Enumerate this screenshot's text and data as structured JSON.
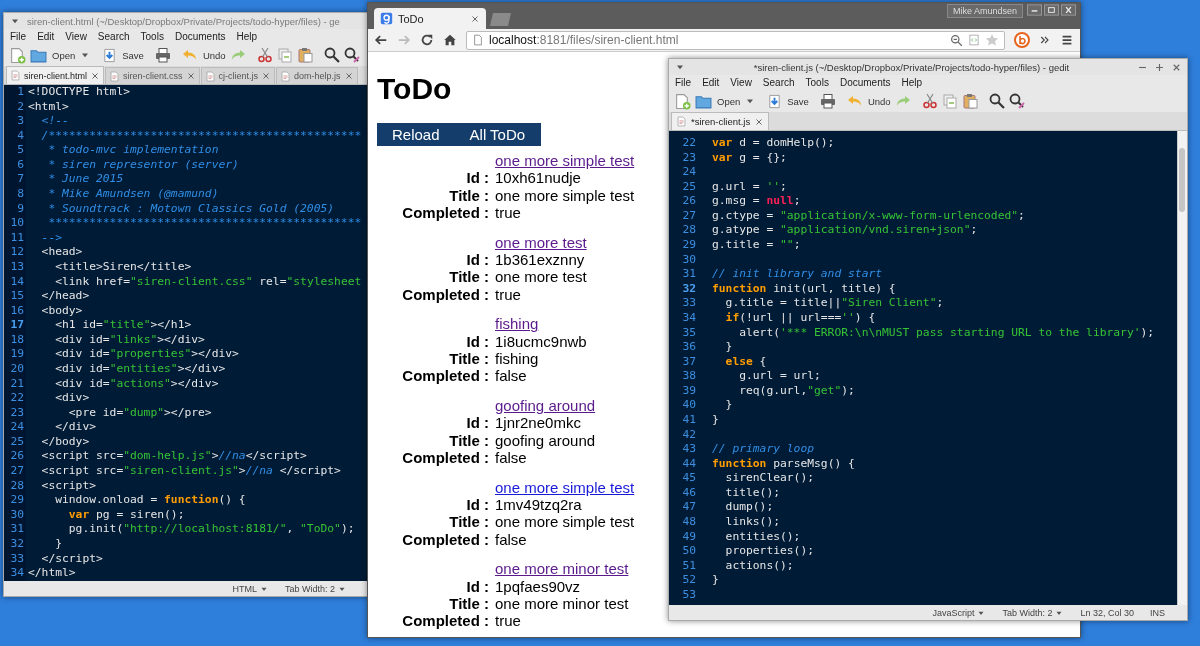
{
  "windows": [
    {
      "kind": "editor",
      "active": false,
      "window_buttons": false,
      "scrollbar": false,
      "title": "siren-client.html (~/Desktop/Dropbox/Private/Projects/todo-hyper/files) - ge",
      "menu": [
        "File",
        "Edit",
        "View",
        "Search",
        "Tools",
        "Documents",
        "Help"
      ],
      "toolbar": {
        "open": "Open",
        "save": "Save",
        "undo": "Undo"
      },
      "tabs": [
        {
          "label": "siren-client.html",
          "selected": true
        },
        {
          "label": "siren-client.css",
          "selected": false
        },
        {
          "label": "cj-client.js",
          "selected": false
        },
        {
          "label": "dom-help.js",
          "selected": false
        }
      ],
      "lines": [
        {
          "number": "1",
          "current": false,
          "tokens": [
            {
              "kind": "text",
              "text": "<!DOCTYPE html>"
            }
          ]
        },
        {
          "number": "2",
          "current": false,
          "tokens": [
            {
              "kind": "text",
              "text": "<html>"
            }
          ]
        },
        {
          "number": "3",
          "current": false,
          "tokens": [
            {
              "kind": "comment",
              "text": "  <!--"
            }
          ]
        },
        {
          "number": "4",
          "current": false,
          "tokens": [
            {
              "kind": "comment",
              "text": "  /**********************************************"
            }
          ]
        },
        {
          "number": "5",
          "current": false,
          "tokens": [
            {
              "kind": "comment",
              "text": "   * todo-mvc implementation"
            }
          ]
        },
        {
          "number": "6",
          "current": false,
          "tokens": [
            {
              "kind": "comment",
              "text": "   * siren representor (server)"
            }
          ]
        },
        {
          "number": "7",
          "current": false,
          "tokens": [
            {
              "kind": "comment",
              "text": "   * June 2015"
            }
          ]
        },
        {
          "number": "8",
          "current": false,
          "tokens": [
            {
              "kind": "comment",
              "text": "   * Mike Amundsen (@mamund)"
            }
          ]
        },
        {
          "number": "9",
          "current": false,
          "tokens": [
            {
              "kind": "comment",
              "text": "   * Soundtrack : Motown Classics Gold (2005)"
            }
          ]
        },
        {
          "number": "10",
          "current": false,
          "tokens": [
            {
              "kind": "comment",
              "text": "   **********************************************"
            }
          ]
        },
        {
          "number": "11",
          "current": false,
          "tokens": [
            {
              "kind": "comment",
              "text": "  -->"
            }
          ]
        },
        {
          "number": "12",
          "current": false,
          "tokens": [
            {
              "kind": "text",
              "text": "  <head>"
            }
          ]
        },
        {
          "number": "13",
          "current": false,
          "tokens": [
            {
              "kind": "text",
              "text": "    <title>Siren</title>"
            }
          ]
        },
        {
          "number": "14",
          "current": false,
          "tokens": [
            {
              "kind": "text",
              "text": "    <link href="
            },
            {
              "kind": "string",
              "text": "\"siren-client.css\""
            },
            {
              "kind": "text",
              "text": " rel="
            },
            {
              "kind": "string",
              "text": "\"stylesheet"
            }
          ]
        },
        {
          "number": "15",
          "current": false,
          "tokens": [
            {
              "kind": "text",
              "text": "  </head>"
            }
          ]
        },
        {
          "number": "16",
          "current": false,
          "tokens": [
            {
              "kind": "text",
              "text": "  <body>"
            }
          ]
        },
        {
          "number": "17",
          "current": true,
          "tokens": [
            {
              "kind": "text",
              "text": "    <h1 id="
            },
            {
              "kind": "string",
              "text": "\"title\""
            },
            {
              "kind": "text",
              "text": "></h1>"
            }
          ]
        },
        {
          "number": "18",
          "current": false,
          "tokens": [
            {
              "kind": "text",
              "text": "    <div id="
            },
            {
              "kind": "string",
              "text": "\"links\""
            },
            {
              "kind": "text",
              "text": "></div>"
            }
          ]
        },
        {
          "number": "19",
          "current": false,
          "tokens": [
            {
              "kind": "text",
              "text": "    <div id="
            },
            {
              "kind": "string",
              "text": "\"properties\""
            },
            {
              "kind": "text",
              "text": "></div>"
            }
          ]
        },
        {
          "number": "20",
          "current": false,
          "tokens": [
            {
              "kind": "text",
              "text": "    <div id="
            },
            {
              "kind": "string",
              "text": "\"entities\""
            },
            {
              "kind": "text",
              "text": "></div>"
            }
          ]
        },
        {
          "number": "21",
          "current": false,
          "tokens": [
            {
              "kind": "text",
              "text": "    <div id="
            },
            {
              "kind": "string",
              "text": "\"actions\""
            },
            {
              "kind": "text",
              "text": "></div>"
            }
          ]
        },
        {
          "number": "22",
          "current": false,
          "tokens": [
            {
              "kind": "text",
              "text": "    <div>"
            }
          ]
        },
        {
          "number": "23",
          "current": false,
          "tokens": [
            {
              "kind": "text",
              "text": "      <pre id="
            },
            {
              "kind": "string",
              "text": "\"dump\""
            },
            {
              "kind": "text",
              "text": "></pre>"
            }
          ]
        },
        {
          "number": "24",
          "current": false,
          "tokens": [
            {
              "kind": "text",
              "text": "    </div>"
            }
          ]
        },
        {
          "number": "25",
          "current": false,
          "tokens": [
            {
              "kind": "text",
              "text": "  </body>"
            }
          ]
        },
        {
          "number": "26",
          "current": false,
          "tokens": [
            {
              "kind": "text",
              "text": "  <script src="
            },
            {
              "kind": "string",
              "text": "\"dom-help.js\""
            },
            {
              "kind": "text",
              "text": ">"
            },
            {
              "kind": "comment",
              "text": "//na"
            },
            {
              "kind": "text",
              "text": "</script>"
            }
          ]
        },
        {
          "number": "27",
          "current": false,
          "tokens": [
            {
              "kind": "text",
              "text": "  <script src="
            },
            {
              "kind": "string",
              "text": "\"siren-client.js\""
            },
            {
              "kind": "text",
              "text": ">"
            },
            {
              "kind": "comment",
              "text": "//na "
            },
            {
              "kind": "text",
              "text": "</script>"
            }
          ]
        },
        {
          "number": "28",
          "current": false,
          "tokens": [
            {
              "kind": "text",
              "text": "  <script>"
            }
          ]
        },
        {
          "number": "29",
          "current": false,
          "tokens": [
            {
              "kind": "text",
              "text": "    window.onload = "
            },
            {
              "kind": "keyword",
              "text": "function"
            },
            {
              "kind": "text",
              "text": "() {"
            }
          ]
        },
        {
          "number": "30",
          "current": false,
          "tokens": [
            {
              "kind": "keyword",
              "text": "      var"
            },
            {
              "kind": "text",
              "text": " pg = siren();"
            }
          ]
        },
        {
          "number": "31",
          "current": false,
          "tokens": [
            {
              "kind": "text",
              "text": "      pg.init("
            },
            {
              "kind": "string",
              "text": "\"http://localhost:8181/\""
            },
            {
              "kind": "text",
              "text": ", "
            },
            {
              "kind": "string",
              "text": "\"ToDo\""
            },
            {
              "kind": "text",
              "text": ");"
            }
          ]
        },
        {
          "number": "32",
          "current": false,
          "tokens": [
            {
              "kind": "text",
              "text": "    }"
            }
          ]
        },
        {
          "number": "33",
          "current": false,
          "tokens": [
            {
              "kind": "text",
              "text": "  </script>"
            }
          ]
        },
        {
          "number": "34",
          "current": false,
          "tokens": [
            {
              "kind": "text",
              "text": "</html>"
            }
          ]
        }
      ],
      "status": [
        {
          "kind": "menu",
          "text": "HTML"
        },
        {
          "kind": "menu",
          "text": "Tab Width: 2"
        }
      ]
    },
    {
      "kind": "browser",
      "window_buttons": true,
      "profile": "Mike Amundsen",
      "tabs": [
        {
          "label": "ToDo",
          "selected": true
        }
      ],
      "address": "**localhost**:8181/files/siren-client.html",
      "page": {
        "heading": "ToDo",
        "nav": [
          "Reload",
          "All ToDo"
        ],
        "items": [
          {
            "link": "one more simple test",
            "visited": true,
            "fields": [
              {
                "label": "Id :",
                "value": "10xh61nudje"
              },
              {
                "label": "Title :",
                "value": "one more simple test"
              },
              {
                "label": "Completed :",
                "value": "true"
              }
            ]
          },
          {
            "link": "one more test",
            "visited": true,
            "fields": [
              {
                "label": "Id :",
                "value": "1b361exznny"
              },
              {
                "label": "Title :",
                "value": "one more test"
              },
              {
                "label": "Completed :",
                "value": "true"
              }
            ]
          },
          {
            "link": "fishing",
            "visited": true,
            "fields": [
              {
                "label": "Id :",
                "value": "1i8ucmc9nwb"
              },
              {
                "label": "Title :",
                "value": "fishing"
              },
              {
                "label": "Completed :",
                "value": "false"
              }
            ]
          },
          {
            "link": "goofing around",
            "visited": true,
            "fields": [
              {
                "label": "Id :",
                "value": "1jnr2ne0mkc"
              },
              {
                "label": "Title :",
                "value": "goofing around"
              },
              {
                "label": "Completed :",
                "value": "false"
              }
            ]
          },
          {
            "link": "one more simple test",
            "visited": false,
            "fields": [
              {
                "label": "Id :",
                "value": "1mv49tzq2ra"
              },
              {
                "label": "Title :",
                "value": "one more simple test"
              },
              {
                "label": "Completed :",
                "value": "false"
              }
            ]
          },
          {
            "link": "one more minor test",
            "visited": true,
            "fields": [
              {
                "label": "Id :",
                "value": "1pqfaes90vz"
              },
              {
                "label": "Title :",
                "value": "one more minor test"
              },
              {
                "label": "Completed :",
                "value": "true"
              }
            ]
          }
        ]
      }
    },
    {
      "kind": "editor",
      "active": true,
      "window_buttons": true,
      "scrollbar": true,
      "title": "*siren-client.js (~/Desktop/Dropbox/Private/Projects/todo-hyper/files) - gedit",
      "menu": [
        "File",
        "Edit",
        "View",
        "Search",
        "Tools",
        "Documents",
        "Help"
      ],
      "toolbar": {
        "open": "Open",
        "save": "Save",
        "undo": "Undo"
      },
      "tabs": [
        {
          "label": "*siren-client.js",
          "selected": true
        }
      ],
      "lines": [
        {
          "number": "22",
          "current": false,
          "tokens": [
            {
              "kind": "keyword",
              "text": "var"
            },
            {
              "kind": "text",
              "text": " d = domHelp();"
            }
          ]
        },
        {
          "number": "23",
          "current": false,
          "tokens": [
            {
              "kind": "keyword",
              "text": "var"
            },
            {
              "kind": "text",
              "text": " g = {};"
            }
          ]
        },
        {
          "number": "24",
          "current": false
        },
        {
          "number": "25",
          "current": false,
          "tokens": [
            {
              "kind": "text",
              "text": "g.url = "
            },
            {
              "kind": "string",
              "text": "''"
            },
            {
              "kind": "text",
              "text": ";"
            }
          ]
        },
        {
          "number": "26",
          "current": false,
          "tokens": [
            {
              "kind": "text",
              "text": "g.msg = "
            },
            {
              "kind": "constant",
              "text": "null"
            },
            {
              "kind": "text",
              "text": ";"
            }
          ]
        },
        {
          "number": "27",
          "current": false,
          "tokens": [
            {
              "kind": "text",
              "text": "g.ctype = "
            },
            {
              "kind": "string",
              "text": "\"application/x-www-form-urlencoded\""
            },
            {
              "kind": "text",
              "text": ";"
            }
          ]
        },
        {
          "number": "28",
          "current": false,
          "tokens": [
            {
              "kind": "text",
              "text": "g.atype = "
            },
            {
              "kind": "string",
              "text": "\"application/vnd.siren+json\""
            },
            {
              "kind": "text",
              "text": ";"
            }
          ]
        },
        {
          "number": "29",
          "current": false,
          "tokens": [
            {
              "kind": "text",
              "text": "g.title = "
            },
            {
              "kind": "string",
              "text": "\"\""
            },
            {
              "kind": "text",
              "text": ";"
            }
          ]
        },
        {
          "number": "30",
          "current": false
        },
        {
          "number": "31",
          "current": false,
          "tokens": [
            {
              "kind": "comment",
              "text": "// init library and start"
            }
          ]
        },
        {
          "number": "32",
          "current": true,
          "tokens": [
            {
              "kind": "keyword",
              "text": "function"
            },
            {
              "kind": "text",
              "text": " init(url, title) {"
            }
          ]
        },
        {
          "number": "33",
          "current": false,
          "tokens": [
            {
              "kind": "text",
              "text": "  g.title = title||"
            },
            {
              "kind": "string",
              "text": "\"Siren Client\""
            },
            {
              "kind": "text",
              "text": ";"
            }
          ]
        },
        {
          "number": "34",
          "current": false,
          "tokens": [
            {
              "kind": "keyword",
              "text": "  if"
            },
            {
              "kind": "text",
              "text": "(!url || url==="
            },
            {
              "kind": "string",
              "text": "''"
            },
            {
              "kind": "text",
              "text": ") {"
            }
          ]
        },
        {
          "number": "35",
          "current": false,
          "tokens": [
            {
              "kind": "text",
              "text": "    alert("
            },
            {
              "kind": "string",
              "text": "'*** ERROR:\\n\\nMUST pass starting URL to the library'"
            },
            {
              "kind": "text",
              "text": ");"
            }
          ]
        },
        {
          "number": "36",
          "current": false,
          "tokens": [
            {
              "kind": "text",
              "text": "  }"
            }
          ]
        },
        {
          "number": "37",
          "current": false,
          "tokens": [
            {
              "kind": "keyword",
              "text": "  else"
            },
            {
              "kind": "text",
              "text": " {"
            }
          ]
        },
        {
          "number": "38",
          "current": false,
          "tokens": [
            {
              "kind": "text",
              "text": "    g.url = url;"
            }
          ]
        },
        {
          "number": "39",
          "current": false,
          "tokens": [
            {
              "kind": "text",
              "text": "    req(g.url,"
            },
            {
              "kind": "string",
              "text": "\"get\""
            },
            {
              "kind": "text",
              "text": ");"
            }
          ]
        },
        {
          "number": "40",
          "current": false,
          "tokens": [
            {
              "kind": "text",
              "text": "  }"
            }
          ]
        },
        {
          "number": "41",
          "current": false,
          "tokens": [
            {
              "kind": "text",
              "text": "}"
            }
          ]
        },
        {
          "number": "42",
          "current": false
        },
        {
          "number": "43",
          "current": false,
          "tokens": [
            {
              "kind": "comment",
              "text": "// primary loop"
            }
          ]
        },
        {
          "number": "44",
          "current": false,
          "tokens": [
            {
              "kind": "keyword",
              "text": "function"
            },
            {
              "kind": "text",
              "text": " parseMsg() {"
            }
          ]
        },
        {
          "number": "45",
          "current": false,
          "tokens": [
            {
              "kind": "text",
              "text": "  sirenClear();"
            }
          ]
        },
        {
          "number": "46",
          "current": false,
          "tokens": [
            {
              "kind": "text",
              "text": "  title();"
            }
          ]
        },
        {
          "number": "47",
          "current": false,
          "tokens": [
            {
              "kind": "text",
              "text": "  dump();"
            }
          ]
        },
        {
          "number": "48",
          "current": false,
          "tokens": [
            {
              "kind": "text",
              "text": "  links();"
            }
          ]
        },
        {
          "number": "49",
          "current": false,
          "tokens": [
            {
              "kind": "text",
              "text": "  entities();"
            }
          ]
        },
        {
          "number": "50",
          "current": false,
          "tokens": [
            {
              "kind": "text",
              "text": "  properties();"
            }
          ]
        },
        {
          "number": "51",
          "current": false,
          "tokens": [
            {
              "kind": "text",
              "text": "  actions();"
            }
          ]
        },
        {
          "number": "52",
          "current": false,
          "tokens": [
            {
              "kind": "text",
              "text": "}"
            }
          ]
        },
        {
          "number": "53",
          "current": false
        }
      ],
      "status": [
        {
          "kind": "menu",
          "text": "JavaScript"
        },
        {
          "kind": "menu",
          "text": "Tab Width: 2"
        },
        {
          "kind": "label",
          "text": "Ln 32, Col 30"
        },
        {
          "kind": "label",
          "text": "INS"
        }
      ]
    }
  ]
}
